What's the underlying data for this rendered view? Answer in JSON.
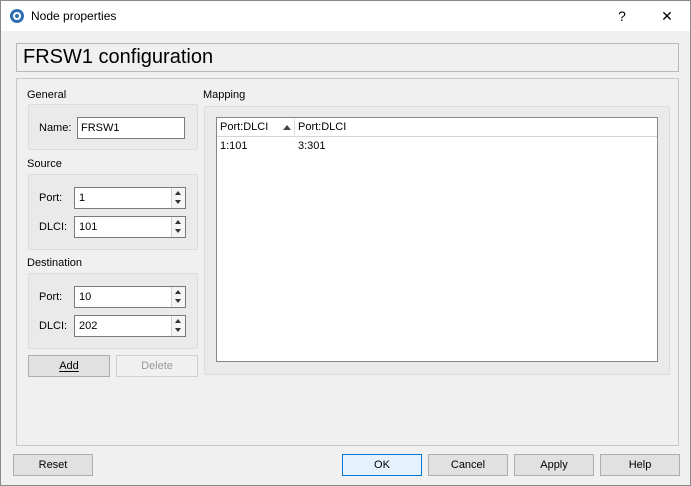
{
  "window": {
    "title": "Node properties",
    "help_label": "?",
    "close_label": "✕"
  },
  "header": {
    "title": "FRSW1 configuration"
  },
  "general": {
    "label": "General",
    "name_label": "Name:",
    "name_value": "FRSW1"
  },
  "source": {
    "label": "Source",
    "port_label": "Port:",
    "port_value": "1",
    "dlci_label": "DLCI:",
    "dlci_value": "101"
  },
  "destination": {
    "label": "Destination",
    "port_label": "Port:",
    "port_value": "10",
    "dlci_label": "DLCI:",
    "dlci_value": "202"
  },
  "actions": {
    "add": "Add",
    "delete": "Delete"
  },
  "mapping": {
    "label": "Mapping",
    "columns": [
      "Port:DLCI",
      "Port:DLCI"
    ],
    "rows": [
      [
        "1:101",
        "3:301"
      ]
    ]
  },
  "footer": {
    "reset": "Reset",
    "ok": "OK",
    "cancel": "Cancel",
    "apply": "Apply",
    "help": "Help"
  }
}
